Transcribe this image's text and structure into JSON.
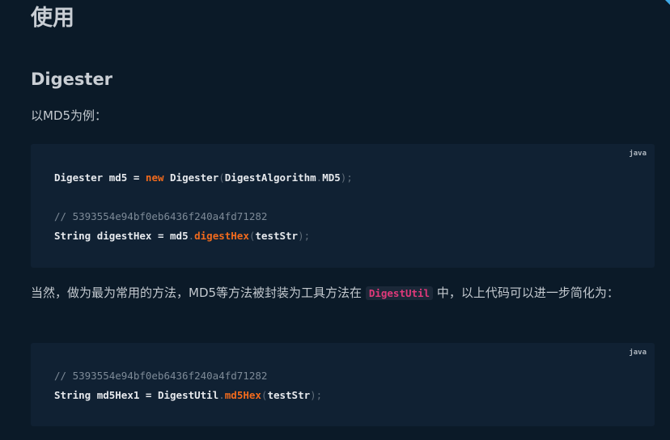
{
  "heading": "使用",
  "subheading": "Digester",
  "intro": "以MD5为例：",
  "block1": {
    "lang": "java",
    "line1": {
      "type": "Digester",
      "var": "md5",
      "eq": "=",
      "kw_new": "new",
      "ctor": "Digester",
      "open": "(",
      "arg_class": "DigestAlgorithm",
      "dot": ".",
      "arg_field": "MD5",
      "close": ");"
    },
    "comment": "// 5393554e94bf0eb6436f240a4fd71282",
    "line3": {
      "type": "String",
      "var": "digestHex",
      "eq": "=",
      "obj": "md5",
      "dot": ".",
      "method": "digestHex",
      "open": "(",
      "arg": "testStr",
      "close": ");"
    }
  },
  "para2": {
    "before": "当然，做为最为常用的方法，MD5等方法被封装为工具方法在 ",
    "code": "DigestUtil",
    "after": " 中，以上代码可以进一步简化为："
  },
  "block2": {
    "lang": "java",
    "comment": "// 5393554e94bf0eb6436f240a4fd71282",
    "line2": {
      "type": "String",
      "var": "md5Hex1",
      "eq": "=",
      "obj": "DigestUtil",
      "dot": ".",
      "method": "md5Hex",
      "open": "(",
      "arg": "testStr",
      "close": ");"
    }
  },
  "colors": {
    "background": "#0b1a28",
    "code_background": "#102133",
    "keyword": "#f06a1d",
    "inline_code": "#e0397a",
    "accent": "#3fa9e6"
  }
}
